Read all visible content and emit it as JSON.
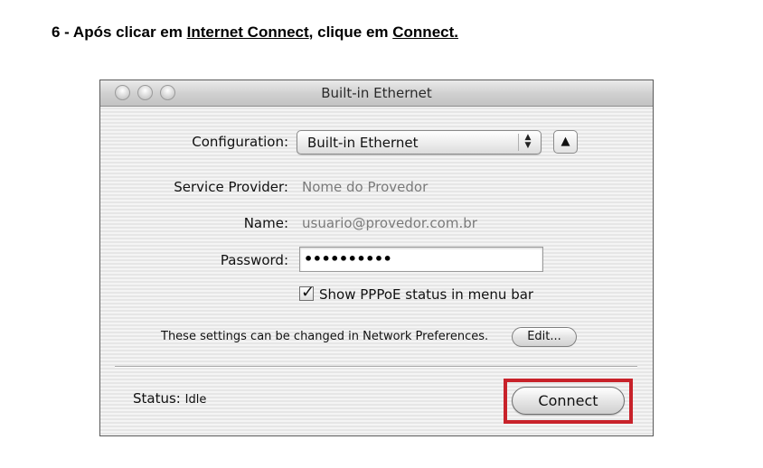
{
  "instruction": {
    "prefix": "6 - Após clicar em ",
    "link1": "Internet Connect",
    "middle": ", clique em ",
    "link2": "Connect."
  },
  "window": {
    "title": "Built-in Ethernet"
  },
  "form": {
    "configuration_label": "Configuration:",
    "configuration_value": "Built-in Ethernet",
    "service_provider_label": "Service Provider:",
    "service_provider_value": "Nome do Provedor",
    "name_label": "Name:",
    "name_value": "usuario@provedor.com.br",
    "password_label": "Password:",
    "password_value": "••••••••••",
    "show_status_label": "Show PPPoE status in menu bar",
    "show_status_checked": true
  },
  "note": {
    "text": "These settings can be changed in Network Preferences.",
    "edit_label": "Edit..."
  },
  "status": {
    "label": "Status:",
    "value": "Idle"
  },
  "buttons": {
    "connect_label": "Connect"
  },
  "colors": {
    "highlight": "#c8222a"
  },
  "icons": {
    "popup_arrows": "up-down-arrows-icon",
    "collapse": "triangle-up-icon",
    "checkmark": "checkmark-icon"
  }
}
